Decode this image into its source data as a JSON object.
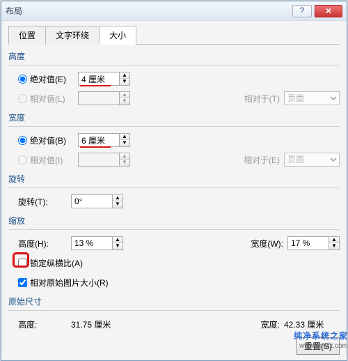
{
  "window": {
    "title": "布局"
  },
  "tabs": {
    "position": "位置",
    "wrap": "文字环绕",
    "size": "大小"
  },
  "height": {
    "title": "高度",
    "absolute_label": "绝对值(E)",
    "absolute_value": "4 厘米",
    "relative_label": "相对值(L)",
    "relative_value": "",
    "relativeto_label": "相对于(T)",
    "relativeto_value": "页面"
  },
  "width": {
    "title": "宽度",
    "absolute_label": "绝对值(B)",
    "absolute_value": "6 厘米",
    "relative_label": "相对值(I)",
    "relative_value": "",
    "relativeto_label": "相对于(E)",
    "relativeto_value": "页面"
  },
  "rotate": {
    "title": "旋转",
    "label": "旋转(T):",
    "value": "0°"
  },
  "scale": {
    "title": "缩放",
    "height_label": "高度(H):",
    "height_value": "13 %",
    "width_label": "宽度(W):",
    "width_value": "17 %",
    "lock_label": "锁定纵横比(A)",
    "orig_label": "相对原始图片大小(R)"
  },
  "original": {
    "title": "原始尺寸",
    "height_label": "高度:",
    "height_value": "31.75 厘米",
    "width_label": "宽度:",
    "width_value": "42.33 厘米"
  },
  "buttons": {
    "reset": "重置(S)"
  },
  "watermark": {
    "brand": "纯净系统之家",
    "url": "www.ycwjz.com"
  }
}
